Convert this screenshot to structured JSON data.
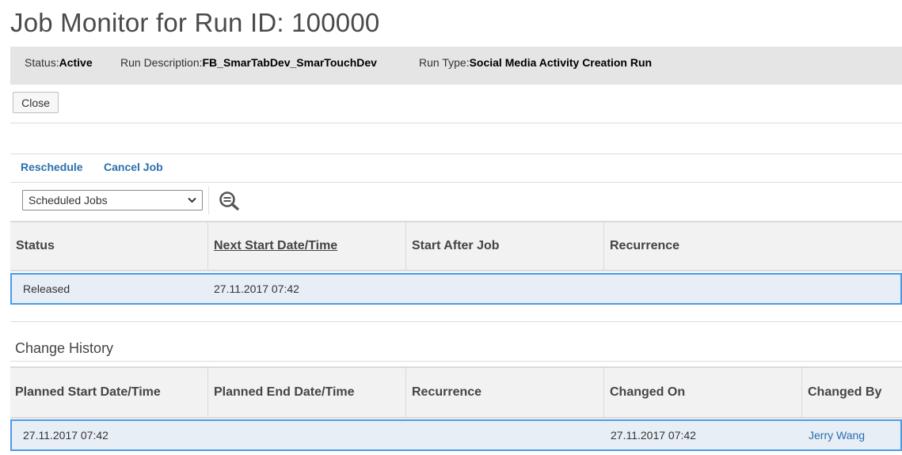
{
  "page": {
    "title": "Job Monitor for Run ID: 100000"
  },
  "header": {
    "status_label": "Status:",
    "status_value": "Active",
    "desc_label": "Run Description:",
    "desc_value": "FB_SmarTabDev_SmarTouchDev",
    "type_label": "Run Type:",
    "type_value": "Social Media Activity Creation Run"
  },
  "toolbar": {
    "close_label": "Close"
  },
  "actions": {
    "reschedule_label": "Reschedule",
    "cancel_label": "Cancel Job"
  },
  "filter": {
    "selected": "Scheduled Jobs",
    "icons": {
      "dropdown": "chevron-down-icon",
      "zoom": "zoom-out-icon"
    }
  },
  "jobs_table": {
    "headers": [
      "Status",
      "Next Start Date/Time",
      "Start After Job",
      "Recurrence"
    ],
    "rows": [
      [
        "Released",
        "27.11.2017 07:42",
        "",
        ""
      ]
    ]
  },
  "history": {
    "title": "Change History",
    "headers": [
      "Planned Start Date/Time",
      "Planned End Date/Time",
      "Recurrence",
      "Changed On",
      "Changed By"
    ],
    "rows": [
      [
        "27.11.2017 07:42",
        "",
        "",
        "27.11.2017 07:42",
        "Jerry Wang"
      ]
    ]
  },
  "colors": {
    "accent_link": "#2a6fad",
    "selection_border": "#4a9be4",
    "selection_fill": "#e8eef6",
    "header_bar": "#e5e5e5"
  }
}
